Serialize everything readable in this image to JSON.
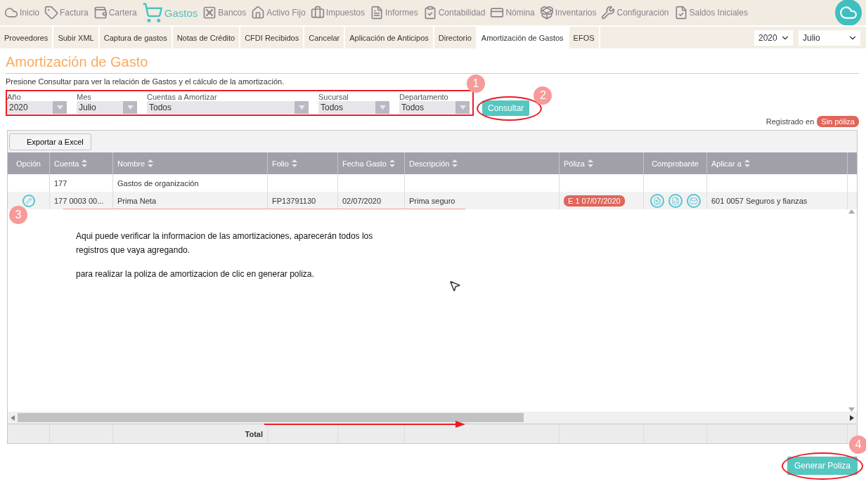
{
  "nav": {
    "items": [
      {
        "label": "Inicio",
        "selected": false
      },
      {
        "label": "Factura",
        "selected": false
      },
      {
        "label": "Cartera",
        "selected": false
      },
      {
        "label": "Gastos",
        "selected": true
      },
      {
        "label": "Bancos",
        "selected": false
      },
      {
        "label": "Activo Fijo",
        "selected": false
      },
      {
        "label": "Impuestos",
        "selected": false
      },
      {
        "label": "Informes",
        "selected": false
      },
      {
        "label": "Contabilidad",
        "selected": false
      },
      {
        "label": "Nómina",
        "selected": false
      },
      {
        "label": "Inventarios",
        "selected": false
      },
      {
        "label": "Configuración",
        "selected": false
      },
      {
        "label": "Saldos Iniciales",
        "selected": false
      }
    ]
  },
  "subnav": {
    "tabs": [
      {
        "label": "Proveedores",
        "selected": false
      },
      {
        "label": "Subir XML",
        "selected": false
      },
      {
        "label": "Captura de gastos",
        "selected": false
      },
      {
        "label": "Notas de Crédito",
        "selected": false
      },
      {
        "label": "CFDI Recibidos",
        "selected": false
      },
      {
        "label": "Cancelar",
        "selected": false
      },
      {
        "label": "Aplicación de Anticipos",
        "selected": false
      },
      {
        "label": "Directorio",
        "selected": false
      },
      {
        "label": "Amortización de Gastos",
        "selected": true
      },
      {
        "label": "EFOS",
        "selected": false
      }
    ],
    "year": "2020",
    "month": "Julio"
  },
  "page": {
    "title": "Amortización de Gasto",
    "hint": "Presione Consultar para ver la relación de Gastos y el cálculo de la amortización."
  },
  "filters": [
    {
      "label": "Año",
      "value": "2020"
    },
    {
      "label": "Mes",
      "value": "Julio"
    },
    {
      "label": "Cuentas a Amortizar",
      "value": "Todos"
    },
    {
      "label": "Sucursal",
      "value": "Todos"
    },
    {
      "label": "Departamento",
      "value": "Todos"
    }
  ],
  "consult_button": "Consultar",
  "registered": {
    "label": "Registrado en",
    "badge": "Sin póliza"
  },
  "export_button": "Exportar a Excel",
  "table": {
    "columns": [
      {
        "label": "Opción",
        "kind": "edit",
        "sortable": false
      },
      {
        "label": "Cuenta",
        "kind": "text",
        "sortable": true
      },
      {
        "label": "Nombre",
        "kind": "text",
        "sortable": true
      },
      {
        "label": "Folio",
        "kind": "text",
        "sortable": true
      },
      {
        "label": "Fecha Gasto",
        "kind": "text",
        "sortable": true
      },
      {
        "label": "Descripción",
        "kind": "text",
        "sortable": true
      },
      {
        "label": "Póliza",
        "kind": "badge",
        "sortable": true
      },
      {
        "label": "Comprobante",
        "kind": "documents",
        "sortable": false
      },
      {
        "label": "Aplicar a",
        "kind": "text",
        "sortable": true
      }
    ],
    "rows": [
      {
        "account": "177",
        "name": "Gastos de organización",
        "editable": false,
        "has_documents": false
      },
      {
        "account": "177 0003 00...",
        "name": "Prima Neta",
        "folio": "FP13791130",
        "date": "02/07/2020",
        "description": "Prima seguro",
        "poliza": "E 1 07/07/2020",
        "apply_to": "601 0057 Seguros y fianzas",
        "editable": true,
        "has_documents": true
      }
    ],
    "footer_label": "Total"
  },
  "generate_button": "Generar Poliza",
  "annotations": {
    "markers": [
      "1",
      "2",
      "3",
      "4"
    ],
    "note": [
      "Aqui puede verificar la informacion de las amortizaciones, aparecerán todos los registros que vaya agregando.",
      "para realizar la poliza de amortizacion de clic en generar poliza."
    ]
  }
}
